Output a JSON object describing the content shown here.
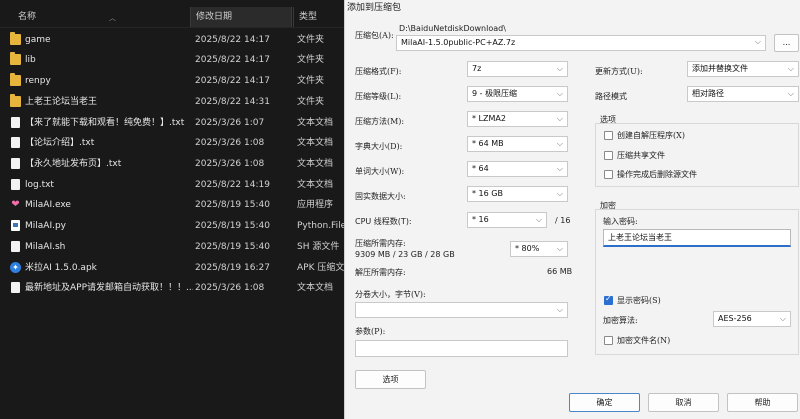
{
  "explorer": {
    "header": {
      "name": "名称",
      "date": "修改日期",
      "type": "类型"
    },
    "rows": [
      {
        "name": "game",
        "date": "2025/8/22 14:17",
        "type": "文件夹",
        "icon": "folder-icon"
      },
      {
        "name": "lib",
        "date": "2025/8/22 14:17",
        "type": "文件夹",
        "icon": "folder-icon"
      },
      {
        "name": "renpy",
        "date": "2025/8/22 14:17",
        "type": "文件夹",
        "icon": "folder-icon"
      },
      {
        "name": "上老王论坛当老王",
        "date": "2025/8/22 14:31",
        "type": "文件夹",
        "icon": "folder-icon"
      },
      {
        "name": "【来了就能下载和观看！纯免费！】.txt",
        "date": "2025/3/26 1:07",
        "type": "文本文档",
        "icon": "text-file-icon"
      },
      {
        "name": "【论坛介绍】.txt",
        "date": "2025/3/26 1:08",
        "type": "文本文档",
        "icon": "text-file-icon"
      },
      {
        "name": "【永久地址发布页】.txt",
        "date": "2025/3/26 1:08",
        "type": "文本文档",
        "icon": "text-file-icon"
      },
      {
        "name": "log.txt",
        "date": "2025/8/22 14:19",
        "type": "文本文档",
        "icon": "text-file-icon"
      },
      {
        "name": "MilaAI.exe",
        "date": "2025/8/19 15:40",
        "type": "应用程序",
        "icon": "app-heart-icon"
      },
      {
        "name": "MilaAI.py",
        "date": "2025/8/19 15:40",
        "type": "Python.File",
        "icon": "python-file-icon"
      },
      {
        "name": "MilaAI.sh",
        "date": "2025/8/19 15:40",
        "type": "SH 源文件",
        "icon": "text-file-icon"
      },
      {
        "name": "米拉AI 1.5.0.apk",
        "date": "2025/8/19 16:27",
        "type": "APK 压缩文",
        "icon": "apk-icon"
      },
      {
        "name": "最新地址及APP请发邮箱自动获取！！！...",
        "date": "2025/3/26 1:08",
        "type": "文本文档",
        "icon": "text-file-icon"
      }
    ]
  },
  "dialog": {
    "title": "添加到压缩包",
    "archive_label": "压缩包(A):",
    "archive_dir": "D:\\BaiduNetdiskDownload\\",
    "archive_file": "MilaAI-1.5.0public-PC+AZ.7z",
    "browse": "...",
    "format_label": "压缩格式(F):",
    "format_value": "7z",
    "level_label": "压缩等级(L):",
    "level_value": "9 - 极限压缩",
    "method_label": "压缩方法(M):",
    "method_value": "* LZMA2",
    "dict_label": "字典大小(D):",
    "dict_value": "* 64 MB",
    "word_label": "单词大小(W):",
    "word_value": "* 64",
    "solid_label": "固实数据大小:",
    "solid_value": "* 16 GB",
    "cpu_label": "CPU 线程数(T):",
    "cpu_value": "* 16",
    "cpu_total": "/ 16",
    "mem_comp_label": "压缩所需内存:",
    "mem_comp_value": "9309 MB / 23 GB / 28 GB",
    "mem_percent": "* 80%",
    "mem_decomp_label": "解压所需内存:",
    "mem_decomp_value": "66 MB",
    "split_label": "分卷大小，字节(V):",
    "split_value": "",
    "params_label": "参数(P):",
    "params_value": "",
    "options_button": "选项",
    "update_label": "更新方式(U):",
    "update_value": "添加并替换文件",
    "path_label": "路径模式",
    "path_value": "相对路径",
    "options_group": "选项",
    "opt_sfx": "创建自解压程序(X)",
    "opt_shared": "压缩共享文件",
    "opt_delete": "操作完成后删除源文件",
    "encrypt_group": "加密",
    "pwd_label": "输入密码:",
    "pwd_value": "上老王论坛当老王",
    "show_pwd": "显示密码(S)",
    "enc_method_label": "加密算法:",
    "enc_method_value": "AES-256",
    "enc_names": "加密文件名(N)",
    "ok": "确定",
    "cancel": "取消",
    "help": "帮助"
  }
}
